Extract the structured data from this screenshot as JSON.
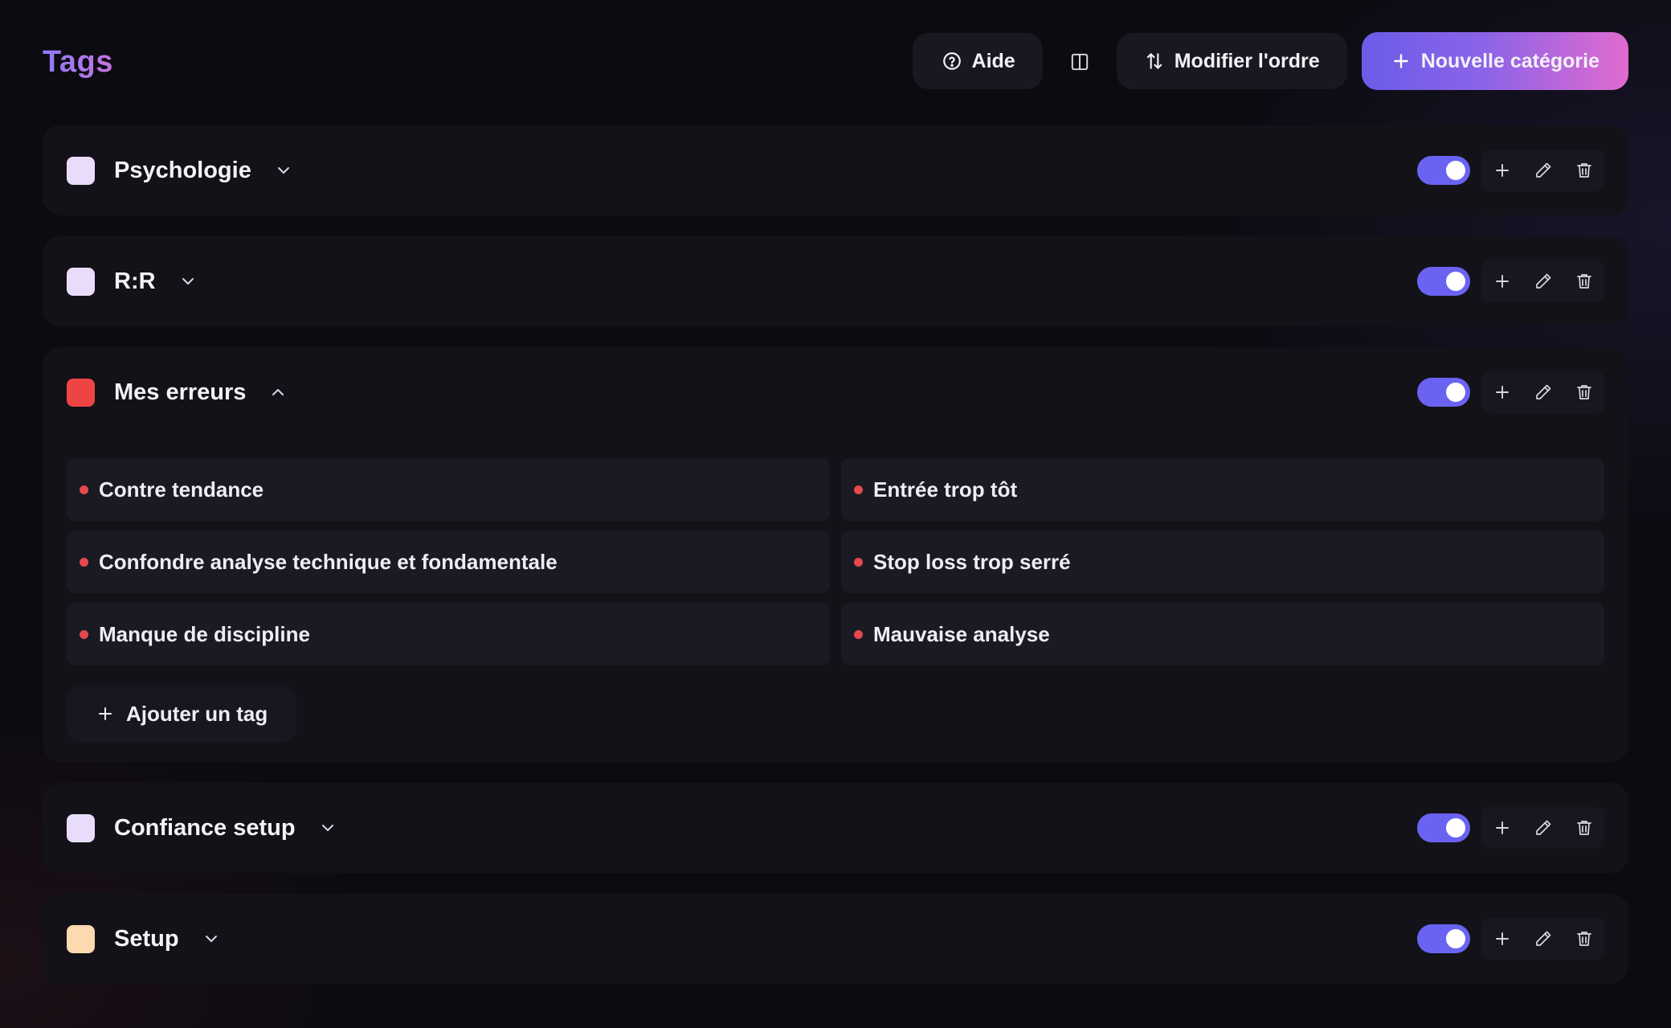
{
  "header": {
    "title": "Tags",
    "help_label": "Aide",
    "reorder_label": "Modifier l'ordre",
    "new_category_label": "Nouvelle catégorie"
  },
  "categories": [
    {
      "name": "Psychologie",
      "color": "#e9dcfb",
      "expanded": false,
      "enabled": true
    },
    {
      "name": "R:R",
      "color": "#e9dcfb",
      "expanded": false,
      "enabled": true
    },
    {
      "name": "Mes erreurs",
      "color": "#ef4444",
      "expanded": true,
      "enabled": true,
      "tags": [
        "Contre tendance",
        "Entrée trop tôt",
        "Confondre analyse technique et fondamentale",
        "Stop loss trop serré",
        "Manque de discipline",
        "Mauvaise analyse"
      ],
      "add_tag_label": "Ajouter un tag"
    },
    {
      "name": "Confiance setup",
      "color": "#e9dcfb",
      "expanded": false,
      "enabled": true
    },
    {
      "name": "Setup",
      "color": "#fdd9b0",
      "expanded": false,
      "enabled": true
    }
  ],
  "colors": {
    "accent": "#6a63f2",
    "tag_dot": "#e5484d",
    "primary_gradient_start": "#6a5ce8",
    "primary_gradient_end": "#e06bd0"
  }
}
